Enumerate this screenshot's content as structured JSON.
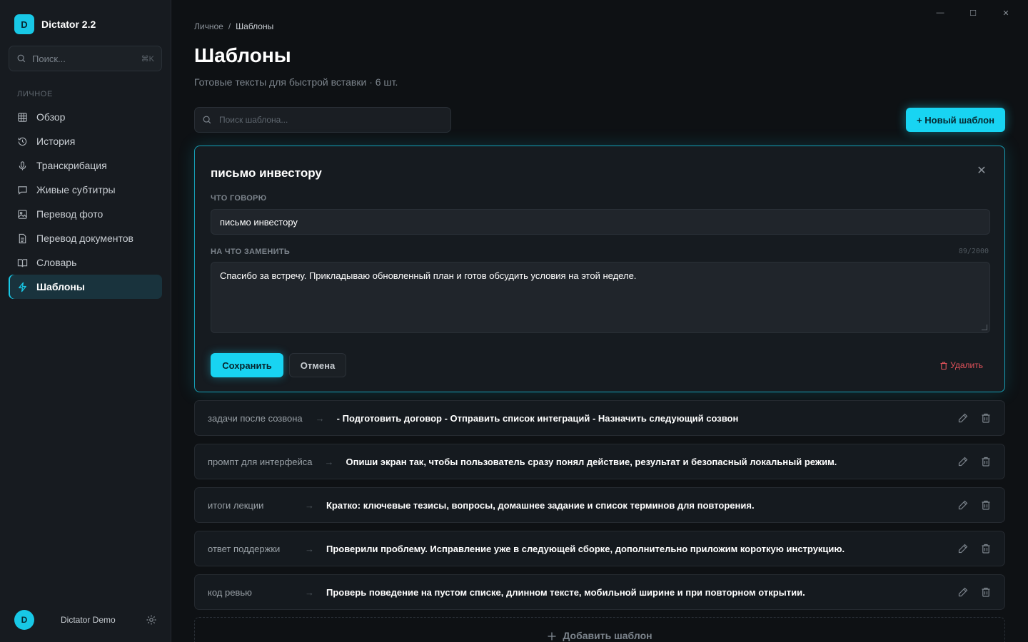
{
  "app": {
    "name": "Dictator 2.2",
    "logo_letter": "D"
  },
  "sidebar": {
    "search_placeholder": "Поиск...",
    "search_shortcut": "⌘K",
    "section_label": "ЛИЧНОЕ",
    "items": [
      {
        "label": "Обзор",
        "icon": "grid-icon"
      },
      {
        "label": "История",
        "icon": "history-icon"
      },
      {
        "label": "Транскрибация",
        "icon": "microphone-icon"
      },
      {
        "label": "Живые субтитры",
        "icon": "chat-bubble-icon"
      },
      {
        "label": "Перевод фото",
        "icon": "image-icon"
      },
      {
        "label": "Перевод документов",
        "icon": "document-icon"
      },
      {
        "label": "Словарь",
        "icon": "book-icon"
      },
      {
        "label": "Шаблоны",
        "icon": "lightning-icon",
        "active": true
      }
    ],
    "user": {
      "initial": "D",
      "name": "Dictator Demo"
    }
  },
  "window_controls": {
    "minimize": "—",
    "maximize": "☐",
    "close": "✕"
  },
  "breadcrumb": {
    "parent": "Личное",
    "separator": "/",
    "current": "Шаблоны"
  },
  "page": {
    "title": "Шаблоны",
    "subtitle": "Готовые тексты для быстрой вставки · 6 шт."
  },
  "toolbar": {
    "search_placeholder": "Поиск шаблона...",
    "new_button": "+ Новый шаблон"
  },
  "editor": {
    "title": "письмо инвестору",
    "close": "✕",
    "trigger_label": "ЧТО ГОВОРЮ",
    "trigger_value": "письмо инвестору",
    "replace_label": "НА ЧТО ЗАМЕНИТЬ",
    "counter": "89/2000",
    "replace_value": "Спасибо за встречу. Прикладываю обновленный план и готов обсудить условия на этой неделе.",
    "save": "Сохранить",
    "cancel": "Отмена",
    "delete": "Удалить"
  },
  "templates": [
    {
      "key": "задачи после созвона",
      "arrow": "→",
      "value": "- Подготовить договор - Отправить список интеграций - Назначить следующий созвон"
    },
    {
      "key": "промпт для интерфейса",
      "arrow": "→",
      "value": "Опиши экран так, чтобы пользователь сразу понял действие, результат и безопасный локальный режим."
    },
    {
      "key": "итоги лекции",
      "arrow": "→",
      "value": "Кратко: ключевые тезисы, вопросы, домашнее задание и список терминов для повторения."
    },
    {
      "key": "ответ поддержки",
      "arrow": "→",
      "value": "Проверили проблему. Исправление уже в следующей сборке, дополнительно приложим короткую инструкцию."
    },
    {
      "key": "код ревью",
      "arrow": "→",
      "value": "Проверь поведение на пустом списке, длинном тексте, мобильной ширине и при повторном открытии."
    }
  ],
  "add_template": "Добавить шаблон",
  "colors": {
    "accent": "#18d4f2",
    "danger": "#e0525a",
    "background": "#0e1114",
    "sidebar": "#171b20"
  }
}
